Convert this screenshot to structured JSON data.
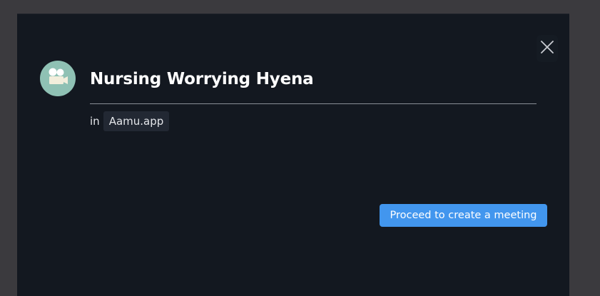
{
  "dialog": {
    "title": "Nursing Worrying Hyena",
    "in_label": "in",
    "organization": "Aamu.app",
    "proceed_label": "Proceed to create a meeting"
  },
  "icons": {
    "avatar": "movie-camera-icon",
    "close": "close-icon"
  },
  "colors": {
    "background_overlay": "#3b3a3e",
    "modal_background": "#131820",
    "avatar_background": "#8fc1b4",
    "primary_button": "#4296ee",
    "chip_background": "#222833"
  }
}
